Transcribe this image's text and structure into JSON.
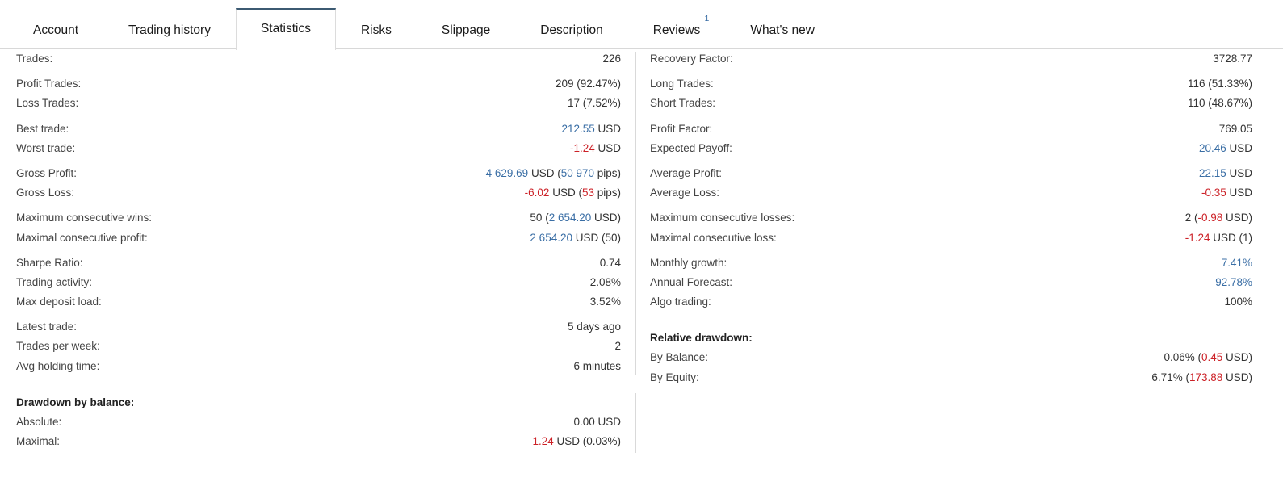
{
  "tabs": [
    {
      "label": "Account",
      "active": false,
      "badge": null
    },
    {
      "label": "Trading history",
      "active": false,
      "badge": null
    },
    {
      "label": "Statistics",
      "active": true,
      "badge": null
    },
    {
      "label": "Risks",
      "active": false,
      "badge": null
    },
    {
      "label": "Slippage",
      "active": false,
      "badge": null
    },
    {
      "label": "Description",
      "active": false,
      "badge": null
    },
    {
      "label": "Reviews",
      "active": false,
      "badge": "1"
    },
    {
      "label": "What's new",
      "active": false,
      "badge": null
    }
  ],
  "colors": {
    "positive": "#3a6ea5",
    "negative": "#cc2127",
    "neutral": "#333333",
    "active_tab_border": "#3c5a72",
    "divider": "#d9d9d9"
  },
  "left_column": {
    "groups": [
      {
        "rows": [
          {
            "label": "Trades:",
            "value": "226",
            "parts": [
              {
                "text": "226",
                "color": "neutral"
              }
            ]
          }
        ]
      },
      {
        "rows": [
          {
            "label": "Profit Trades:",
            "value": "209 (92.47%)",
            "parts": [
              {
                "text": "209 (92.47%)",
                "color": "neutral"
              }
            ]
          },
          {
            "label": "Loss Trades:",
            "value": "17 (7.52%)",
            "parts": [
              {
                "text": "17 (7.52%)",
                "color": "neutral"
              }
            ]
          }
        ]
      },
      {
        "rows": [
          {
            "label": "Best trade:",
            "value": "212.55 USD",
            "parts": [
              {
                "text": "212.55",
                "color": "positive"
              },
              {
                "text": " USD",
                "color": "neutral"
              }
            ]
          },
          {
            "label": "Worst trade:",
            "value": "-1.24 USD",
            "parts": [
              {
                "text": "-1.24",
                "color": "negative"
              },
              {
                "text": " USD",
                "color": "neutral"
              }
            ]
          }
        ]
      },
      {
        "rows": [
          {
            "label": "Gross Profit:",
            "value": "4 629.69 USD (50 970 pips)",
            "parts": [
              {
                "text": "4 629.69",
                "color": "positive"
              },
              {
                "text": " USD (",
                "color": "neutral"
              },
              {
                "text": "50 970",
                "color": "positive"
              },
              {
                "text": " pips)",
                "color": "neutral"
              }
            ]
          },
          {
            "label": "Gross Loss:",
            "value": "-6.02 USD (53 pips)",
            "parts": [
              {
                "text": "-6.02",
                "color": "negative"
              },
              {
                "text": " USD (",
                "color": "neutral"
              },
              {
                "text": "53",
                "color": "negative"
              },
              {
                "text": " pips)",
                "color": "neutral"
              }
            ]
          }
        ]
      },
      {
        "rows": [
          {
            "label": "Maximum consecutive wins:",
            "value": "50 (2 654.20 USD)",
            "parts": [
              {
                "text": "50 (",
                "color": "neutral"
              },
              {
                "text": "2 654.20",
                "color": "positive"
              },
              {
                "text": " USD)",
                "color": "neutral"
              }
            ]
          },
          {
            "label": "Maximal consecutive profit:",
            "value": "2 654.20 USD (50)",
            "parts": [
              {
                "text": "2 654.20",
                "color": "positive"
              },
              {
                "text": " USD (50)",
                "color": "neutral"
              }
            ]
          }
        ]
      },
      {
        "rows": [
          {
            "label": "Sharpe Ratio:",
            "value": "0.74",
            "parts": [
              {
                "text": "0.74",
                "color": "neutral"
              }
            ]
          },
          {
            "label": "Trading activity:",
            "value": "2.08%",
            "parts": [
              {
                "text": "2.08%",
                "color": "neutral"
              }
            ]
          },
          {
            "label": "Max deposit load:",
            "value": "3.52%",
            "parts": [
              {
                "text": "3.52%",
                "color": "neutral"
              }
            ]
          }
        ]
      },
      {
        "rows": [
          {
            "label": "Latest trade:",
            "value": "5 days ago",
            "parts": [
              {
                "text": "5 days ago",
                "color": "neutral"
              }
            ]
          },
          {
            "label": "Trades per week:",
            "value": "2",
            "parts": [
              {
                "text": "2",
                "color": "neutral"
              }
            ]
          },
          {
            "label": "Avg holding time:",
            "value": "6 minutes",
            "parts": [
              {
                "text": "6 minutes",
                "color": "neutral"
              }
            ]
          }
        ]
      }
    ],
    "drawdown": {
      "heading": "Drawdown by balance:",
      "rows": [
        {
          "label": "Absolute:",
          "value": "0.00 USD",
          "parts": [
            {
              "text": "0.00 USD",
              "color": "neutral"
            }
          ]
        },
        {
          "label": "Maximal:",
          "value": "1.24 USD (0.03%)",
          "parts": [
            {
              "text": "1.24",
              "color": "negative"
            },
            {
              "text": " USD (0.03%)",
              "color": "neutral"
            }
          ]
        }
      ]
    }
  },
  "right_column": {
    "groups": [
      {
        "rows": [
          {
            "label": "Recovery Factor:",
            "value": "3728.77",
            "parts": [
              {
                "text": "3728.77",
                "color": "neutral"
              }
            ]
          }
        ]
      },
      {
        "rows": [
          {
            "label": "Long Trades:",
            "value": "116 (51.33%)",
            "parts": [
              {
                "text": "116 (51.33%)",
                "color": "neutral"
              }
            ]
          },
          {
            "label": "Short Trades:",
            "value": "110 (48.67%)",
            "parts": [
              {
                "text": "110 (48.67%)",
                "color": "neutral"
              }
            ]
          }
        ]
      },
      {
        "rows": [
          {
            "label": "Profit Factor:",
            "value": "769.05",
            "parts": [
              {
                "text": "769.05",
                "color": "neutral"
              }
            ]
          },
          {
            "label": "Expected Payoff:",
            "value": "20.46 USD",
            "parts": [
              {
                "text": "20.46",
                "color": "positive"
              },
              {
                "text": " USD",
                "color": "neutral"
              }
            ]
          }
        ]
      },
      {
        "rows": [
          {
            "label": "Average Profit:",
            "value": "22.15 USD",
            "parts": [
              {
                "text": "22.15",
                "color": "positive"
              },
              {
                "text": " USD",
                "color": "neutral"
              }
            ]
          },
          {
            "label": "Average Loss:",
            "value": "-0.35 USD",
            "parts": [
              {
                "text": "-0.35",
                "color": "negative"
              },
              {
                "text": " USD",
                "color": "neutral"
              }
            ]
          }
        ]
      },
      {
        "rows": [
          {
            "label": "Maximum consecutive losses:",
            "value": "2 (-0.98 USD)",
            "parts": [
              {
                "text": "2 (",
                "color": "neutral"
              },
              {
                "text": "-0.98",
                "color": "negative"
              },
              {
                "text": " USD)",
                "color": "neutral"
              }
            ]
          },
          {
            "label": "Maximal consecutive loss:",
            "value": "-1.24 USD (1)",
            "parts": [
              {
                "text": "-1.24",
                "color": "negative"
              },
              {
                "text": " USD (1)",
                "color": "neutral"
              }
            ]
          }
        ]
      },
      {
        "rows": [
          {
            "label": "Monthly growth:",
            "value": "7.41%",
            "parts": [
              {
                "text": "7.41%",
                "color": "positive"
              }
            ]
          },
          {
            "label": "Annual Forecast:",
            "value": "92.78%",
            "parts": [
              {
                "text": "92.78%",
                "color": "positive"
              }
            ]
          },
          {
            "label": "Algo trading:",
            "value": "100%",
            "parts": [
              {
                "text": "100%",
                "color": "neutral"
              }
            ]
          }
        ]
      }
    ],
    "drawdown": {
      "heading": "Relative drawdown:",
      "rows": [
        {
          "label": "By Balance:",
          "value": "0.06% (0.45 USD)",
          "parts": [
            {
              "text": "0.06% (",
              "color": "neutral"
            },
            {
              "text": "0.45",
              "color": "negative"
            },
            {
              "text": " USD)",
              "color": "neutral"
            }
          ]
        },
        {
          "label": "By Equity:",
          "value": "6.71% (173.88 USD)",
          "parts": [
            {
              "text": "6.71% (",
              "color": "neutral"
            },
            {
              "text": "173.88",
              "color": "negative"
            },
            {
              "text": " USD)",
              "color": "neutral"
            }
          ]
        }
      ]
    }
  }
}
